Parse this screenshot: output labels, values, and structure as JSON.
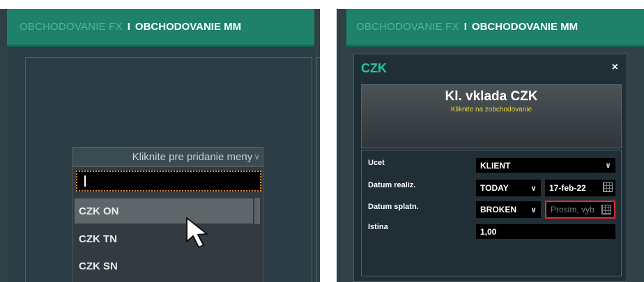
{
  "tabs": {
    "inactive": "OBCHODOVANIE FX",
    "separator": "I",
    "active": "OBCHODOVANIE MM"
  },
  "left": {
    "dropdown_header": "Kliknite pre pridanie meny",
    "search_value": "",
    "items": [
      "CZK ON",
      "CZK TN",
      "CZK SN"
    ],
    "highlighted_index": 0
  },
  "dialog": {
    "title": "CZK",
    "close": "×",
    "trade_title": "Kl. vklada CZK",
    "trade_subtitle": "Kliknite na zobchodovanie",
    "fields": {
      "account_label": "Ucet",
      "account_value": "KLIENT",
      "value_date_label": "Datum realiz.",
      "value_date_tenor": "TODAY",
      "value_date": "17-feb-22",
      "maturity_label": "Datum splatn.",
      "maturity_tenor": "BROKEN",
      "maturity_placeholder": "Prosim, vyb",
      "principal_label": "Istina",
      "principal_value": "1,00"
    }
  },
  "colors": {
    "tab_bar": "#1d8268",
    "tab_inactive_text": "#4bb798",
    "dialog_title": "#24c79c",
    "subtitle_yellow": "#e5d548",
    "error_border": "#d5303a",
    "focus_outline": "#e08a2a"
  }
}
